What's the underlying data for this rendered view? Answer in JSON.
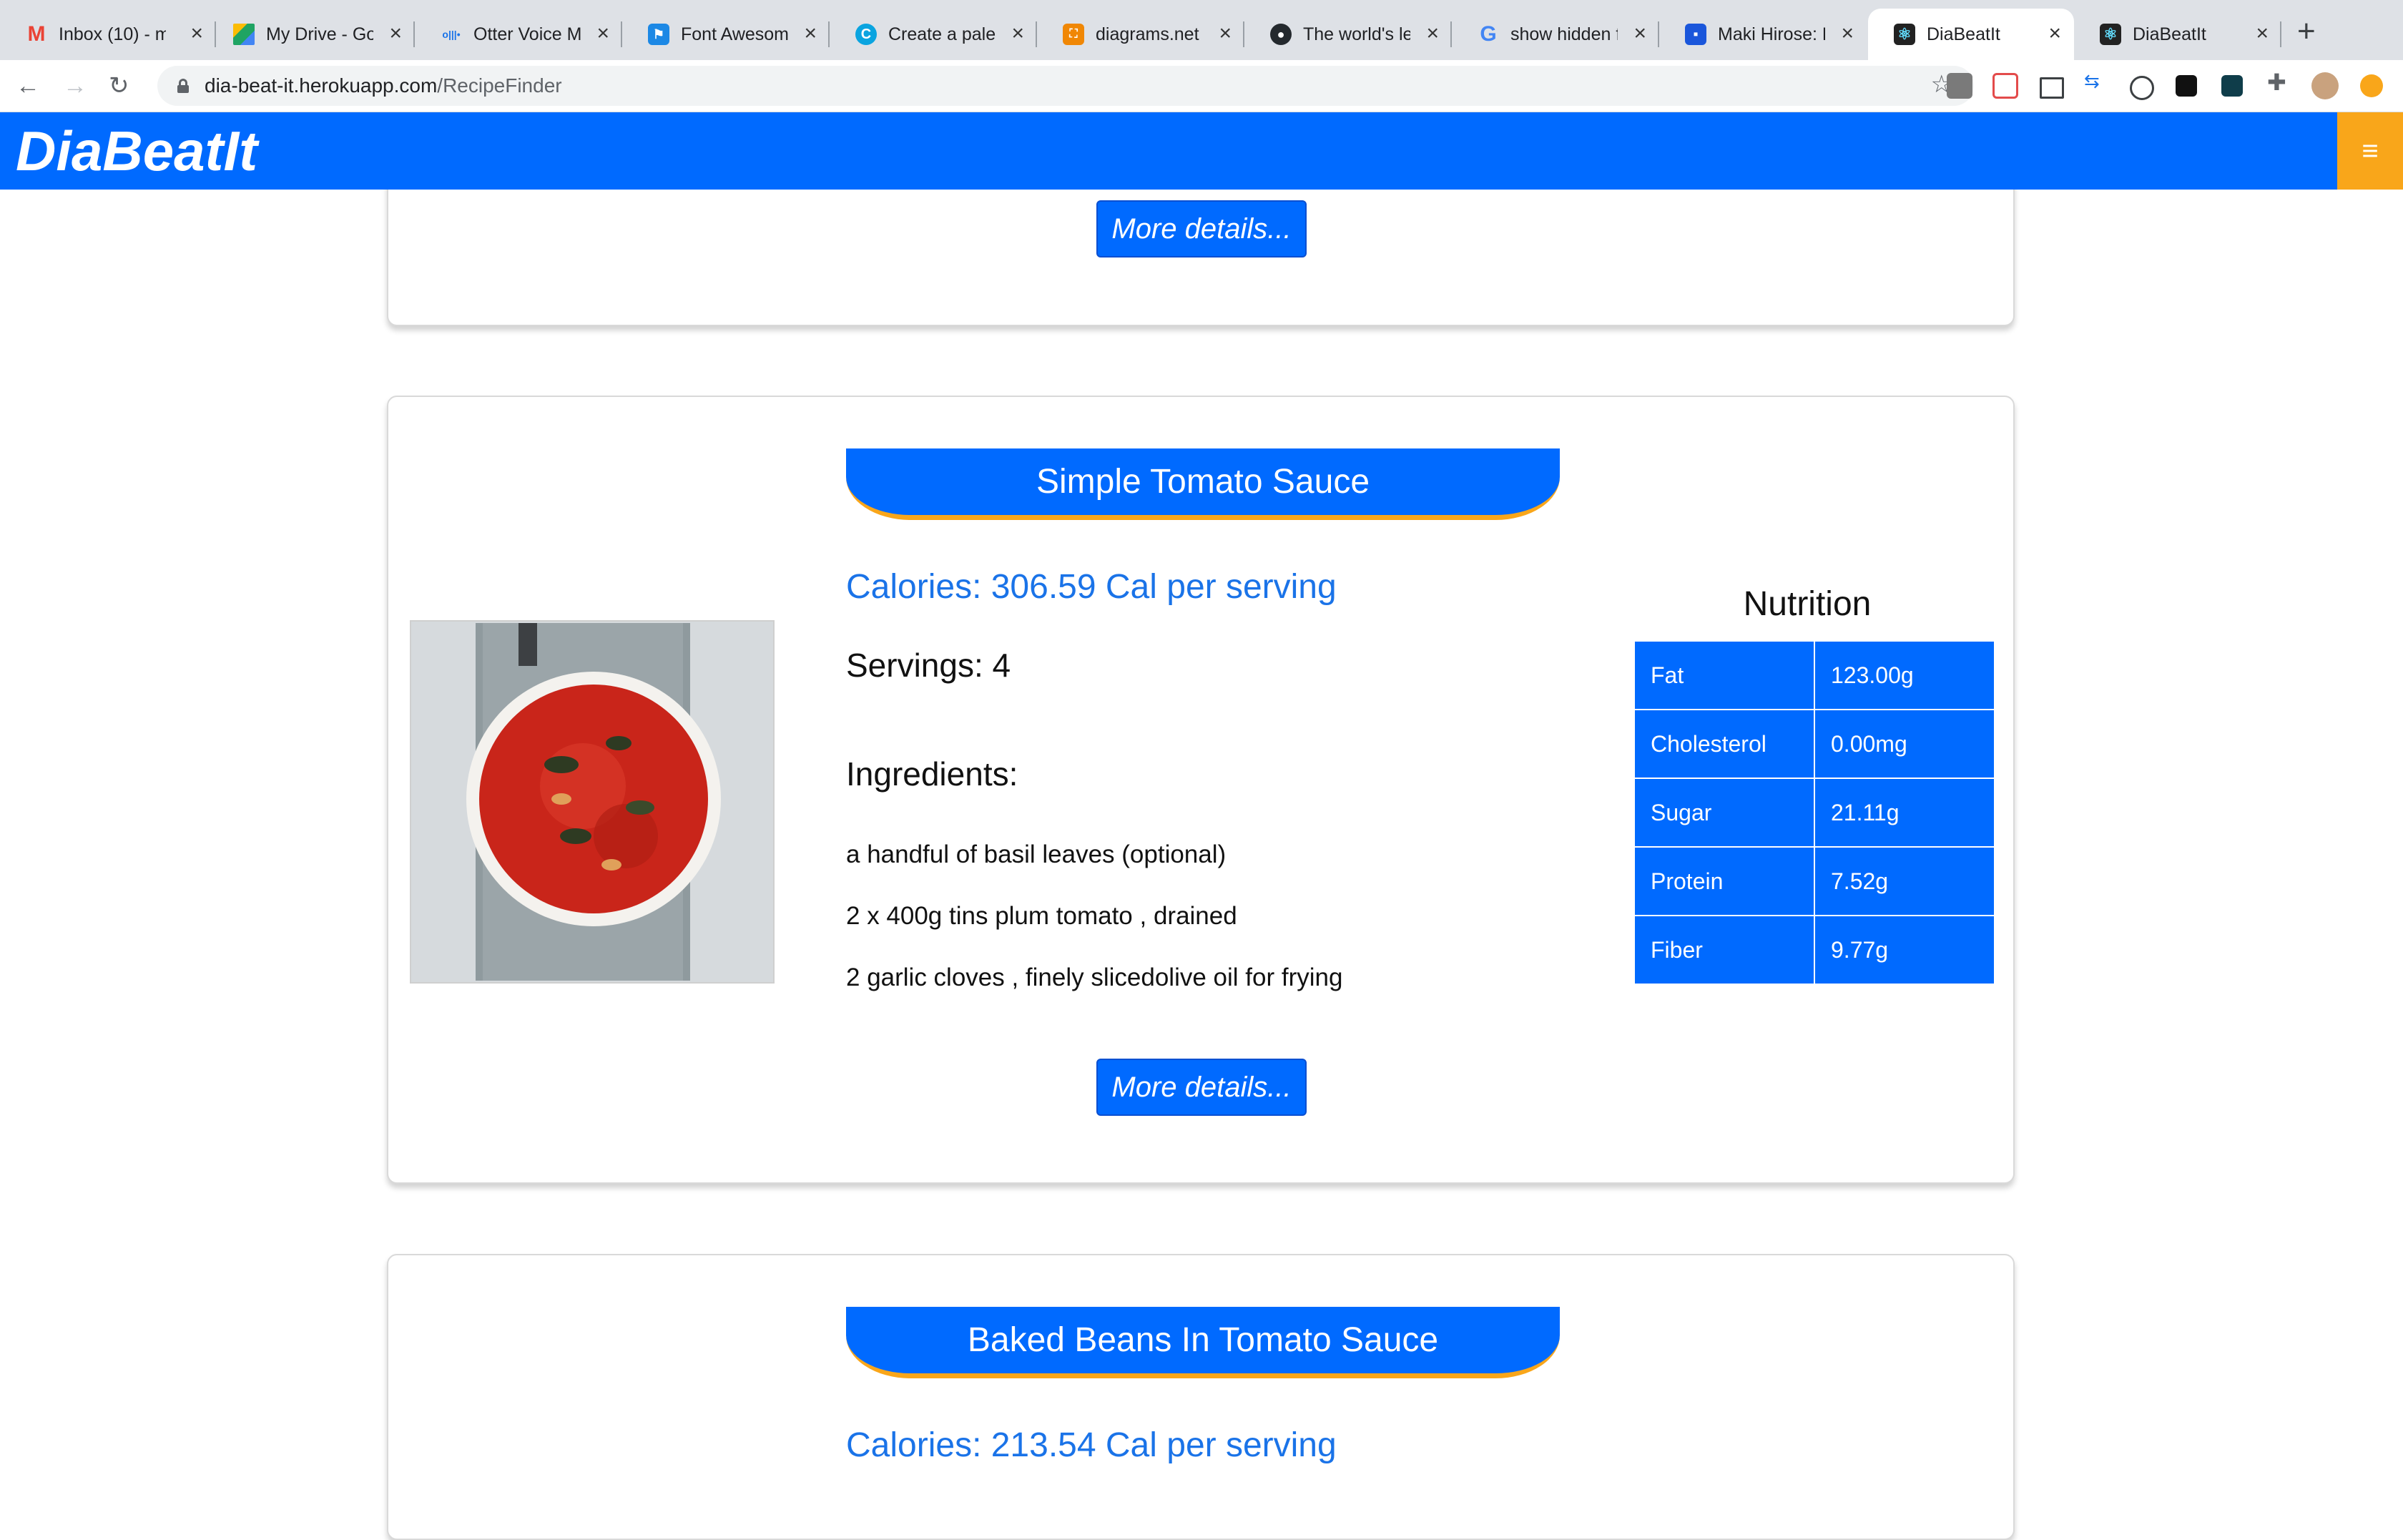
{
  "browser": {
    "tabs": [
      {
        "title": "Inbox (10) - m",
        "icon": "gmail-icon",
        "color": "#ea4335"
      },
      {
        "title": "My Drive - Go",
        "icon": "drive-icon",
        "color": "#1fa463"
      },
      {
        "title": "Otter Voice M",
        "icon": "otter-icon",
        "color": "#1a73e8"
      },
      {
        "title": "Font Awesome",
        "icon": "flag-icon",
        "color": "#1c88e5"
      },
      {
        "title": "Create a palet",
        "icon": "coolors-icon",
        "color": "#0aa4e0"
      },
      {
        "title": "diagrams.net",
        "icon": "diagrams-icon",
        "color": "#f08705"
      },
      {
        "title": "The world's le",
        "icon": "github-icon",
        "color": "#24292e"
      },
      {
        "title": "show hidden f",
        "icon": "google-icon",
        "color": "#4285f4"
      },
      {
        "title": "Maki Hirose: L",
        "icon": "profile-icon",
        "color": "#1a56db"
      },
      {
        "title": "DiaBeatIt",
        "icon": "react-icon",
        "color": "#222222",
        "active": true
      },
      {
        "title": "DiaBeatIt",
        "icon": "react-icon",
        "color": "#222222"
      }
    ],
    "url_host": "dia-beat-it.herokuapp.com",
    "url_path": "/RecipeFinder"
  },
  "app": {
    "brand": "DiaBeatIt",
    "menu_icon": "hamburger-icon",
    "accent": "#006aff",
    "secondary": "#f9a61a"
  },
  "cards": [
    {
      "more_label": "More details..."
    },
    {
      "title": "Simple Tomato Sauce",
      "calories": "Calories: 306.59 Cal per serving",
      "servings": "Servings: 4",
      "ingredients_heading": "Ingredients:",
      "ingredients": [
        "a handful of basil leaves (optional)",
        "2 x 400g tins plum tomato , drained",
        "2 garlic cloves , finely slicedolive oil for frying"
      ],
      "nutrition_title": "Nutrition",
      "nutrition": [
        {
          "label": "Fat",
          "value": "123.00g"
        },
        {
          "label": "Cholesterol",
          "value": "0.00mg"
        },
        {
          "label": "Sugar",
          "value": "21.11g"
        },
        {
          "label": "Protein",
          "value": "7.52g"
        },
        {
          "label": "Fiber",
          "value": "9.77g"
        }
      ],
      "more_label": "More details..."
    },
    {
      "title": "Baked Beans In Tomato Sauce",
      "calories": "Calories: 213.54 Cal per serving"
    }
  ]
}
